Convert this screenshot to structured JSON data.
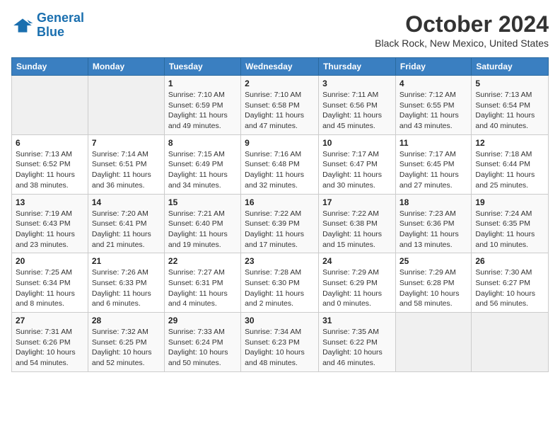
{
  "header": {
    "logo_line1": "General",
    "logo_line2": "Blue",
    "month": "October 2024",
    "location": "Black Rock, New Mexico, United States"
  },
  "days_of_week": [
    "Sunday",
    "Monday",
    "Tuesday",
    "Wednesday",
    "Thursday",
    "Friday",
    "Saturday"
  ],
  "weeks": [
    [
      {
        "day": "",
        "info": ""
      },
      {
        "day": "",
        "info": ""
      },
      {
        "day": "1",
        "info": "Sunrise: 7:10 AM\nSunset: 6:59 PM\nDaylight: 11 hours and 49 minutes."
      },
      {
        "day": "2",
        "info": "Sunrise: 7:10 AM\nSunset: 6:58 PM\nDaylight: 11 hours and 47 minutes."
      },
      {
        "day": "3",
        "info": "Sunrise: 7:11 AM\nSunset: 6:56 PM\nDaylight: 11 hours and 45 minutes."
      },
      {
        "day": "4",
        "info": "Sunrise: 7:12 AM\nSunset: 6:55 PM\nDaylight: 11 hours and 43 minutes."
      },
      {
        "day": "5",
        "info": "Sunrise: 7:13 AM\nSunset: 6:54 PM\nDaylight: 11 hours and 40 minutes."
      }
    ],
    [
      {
        "day": "6",
        "info": "Sunrise: 7:13 AM\nSunset: 6:52 PM\nDaylight: 11 hours and 38 minutes."
      },
      {
        "day": "7",
        "info": "Sunrise: 7:14 AM\nSunset: 6:51 PM\nDaylight: 11 hours and 36 minutes."
      },
      {
        "day": "8",
        "info": "Sunrise: 7:15 AM\nSunset: 6:49 PM\nDaylight: 11 hours and 34 minutes."
      },
      {
        "day": "9",
        "info": "Sunrise: 7:16 AM\nSunset: 6:48 PM\nDaylight: 11 hours and 32 minutes."
      },
      {
        "day": "10",
        "info": "Sunrise: 7:17 AM\nSunset: 6:47 PM\nDaylight: 11 hours and 30 minutes."
      },
      {
        "day": "11",
        "info": "Sunrise: 7:17 AM\nSunset: 6:45 PM\nDaylight: 11 hours and 27 minutes."
      },
      {
        "day": "12",
        "info": "Sunrise: 7:18 AM\nSunset: 6:44 PM\nDaylight: 11 hours and 25 minutes."
      }
    ],
    [
      {
        "day": "13",
        "info": "Sunrise: 7:19 AM\nSunset: 6:43 PM\nDaylight: 11 hours and 23 minutes."
      },
      {
        "day": "14",
        "info": "Sunrise: 7:20 AM\nSunset: 6:41 PM\nDaylight: 11 hours and 21 minutes."
      },
      {
        "day": "15",
        "info": "Sunrise: 7:21 AM\nSunset: 6:40 PM\nDaylight: 11 hours and 19 minutes."
      },
      {
        "day": "16",
        "info": "Sunrise: 7:22 AM\nSunset: 6:39 PM\nDaylight: 11 hours and 17 minutes."
      },
      {
        "day": "17",
        "info": "Sunrise: 7:22 AM\nSunset: 6:38 PM\nDaylight: 11 hours and 15 minutes."
      },
      {
        "day": "18",
        "info": "Sunrise: 7:23 AM\nSunset: 6:36 PM\nDaylight: 11 hours and 13 minutes."
      },
      {
        "day": "19",
        "info": "Sunrise: 7:24 AM\nSunset: 6:35 PM\nDaylight: 11 hours and 10 minutes."
      }
    ],
    [
      {
        "day": "20",
        "info": "Sunrise: 7:25 AM\nSunset: 6:34 PM\nDaylight: 11 hours and 8 minutes."
      },
      {
        "day": "21",
        "info": "Sunrise: 7:26 AM\nSunset: 6:33 PM\nDaylight: 11 hours and 6 minutes."
      },
      {
        "day": "22",
        "info": "Sunrise: 7:27 AM\nSunset: 6:31 PM\nDaylight: 11 hours and 4 minutes."
      },
      {
        "day": "23",
        "info": "Sunrise: 7:28 AM\nSunset: 6:30 PM\nDaylight: 11 hours and 2 minutes."
      },
      {
        "day": "24",
        "info": "Sunrise: 7:29 AM\nSunset: 6:29 PM\nDaylight: 11 hours and 0 minutes."
      },
      {
        "day": "25",
        "info": "Sunrise: 7:29 AM\nSunset: 6:28 PM\nDaylight: 10 hours and 58 minutes."
      },
      {
        "day": "26",
        "info": "Sunrise: 7:30 AM\nSunset: 6:27 PM\nDaylight: 10 hours and 56 minutes."
      }
    ],
    [
      {
        "day": "27",
        "info": "Sunrise: 7:31 AM\nSunset: 6:26 PM\nDaylight: 10 hours and 54 minutes."
      },
      {
        "day": "28",
        "info": "Sunrise: 7:32 AM\nSunset: 6:25 PM\nDaylight: 10 hours and 52 minutes."
      },
      {
        "day": "29",
        "info": "Sunrise: 7:33 AM\nSunset: 6:24 PM\nDaylight: 10 hours and 50 minutes."
      },
      {
        "day": "30",
        "info": "Sunrise: 7:34 AM\nSunset: 6:23 PM\nDaylight: 10 hours and 48 minutes."
      },
      {
        "day": "31",
        "info": "Sunrise: 7:35 AM\nSunset: 6:22 PM\nDaylight: 10 hours and 46 minutes."
      },
      {
        "day": "",
        "info": ""
      },
      {
        "day": "",
        "info": ""
      }
    ]
  ]
}
